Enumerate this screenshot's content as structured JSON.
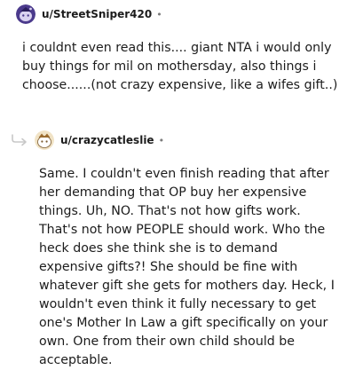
{
  "comments": [
    {
      "username": "u/StreetSniper420",
      "separator": "•",
      "avatar": "snoo-avatar-purple",
      "text": "i couldnt even read this.... giant NTA i would only buy things for mil on mothersday, also things i choose......(not crazy expensive, like a wifes gift..)"
    },
    {
      "username": "u/crazycatleslie",
      "separator": "•",
      "avatar": "snoo-avatar-beige",
      "text": "Same. I couldn't even finish reading that after her demanding that OP buy her expensive things. Uh, NO. That's not how gifts work. That's not how PEOPLE should work. Who the heck does she think she is to demand expensive gifts?! She should be fine with whatever gift she gets for mothers day. Heck, I wouldn't even think it fully necessary to get one's Mother In Law a gift specifically on your own. One from their own child should be acceptable."
    }
  ],
  "colors": {
    "text": "#1c1c1c",
    "meta": "#7c7c7c",
    "reply_arrow": "#c8c8c8"
  },
  "icons": [
    "reply-arrow-icon"
  ]
}
